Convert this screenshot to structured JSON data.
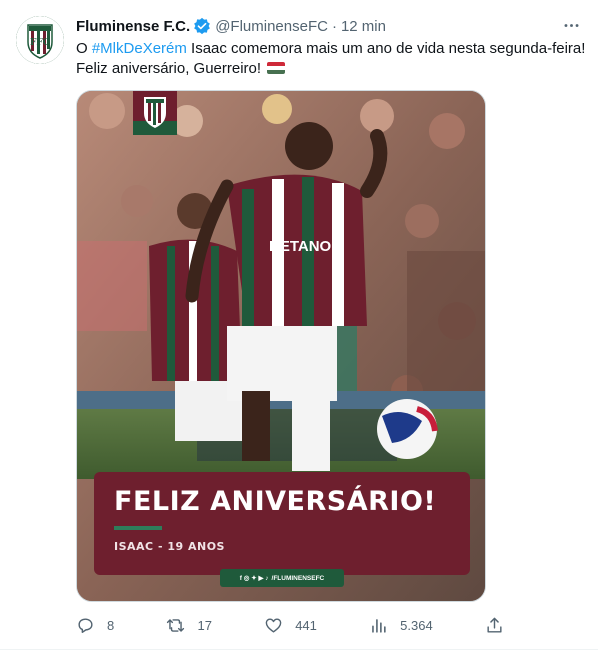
{
  "author": {
    "name": "Fluminense F.C.",
    "handle": "@FluminenseFC",
    "separator": "·",
    "time": "12 min",
    "verified": true
  },
  "tweet": {
    "text_prefix": "O ",
    "hashtag": "#MlkDeXerém",
    "text_line1_rest": " Isaac comemora mais um ano de vida nesta segunda-feira!",
    "text_line2": "Feliz aniversário, Guerreiro! ",
    "flag_emoji_name": "hungary-flag",
    "flag_colors": [
      "#ce2939",
      "#ffffff",
      "#477050"
    ]
  },
  "media": {
    "banner_title": "FELIZ ANIVERSÁRIO!",
    "banner_subtitle": "ISAAC - 19 ANOS",
    "social_handle": "/FLUMINENSEFC",
    "jersey_sponsor": "BETANO",
    "colors": {
      "grena": "#6e1f2e",
      "verde": "#1f5a3b",
      "accent_bar": "#2e7d5b"
    }
  },
  "actions": {
    "replies": "8",
    "retweets": "17",
    "likes": "441",
    "views": "5.364"
  },
  "icons": [
    "more-icon",
    "verified-icon",
    "reply-icon",
    "retweet-icon",
    "like-icon",
    "views-icon",
    "share-icon"
  ]
}
